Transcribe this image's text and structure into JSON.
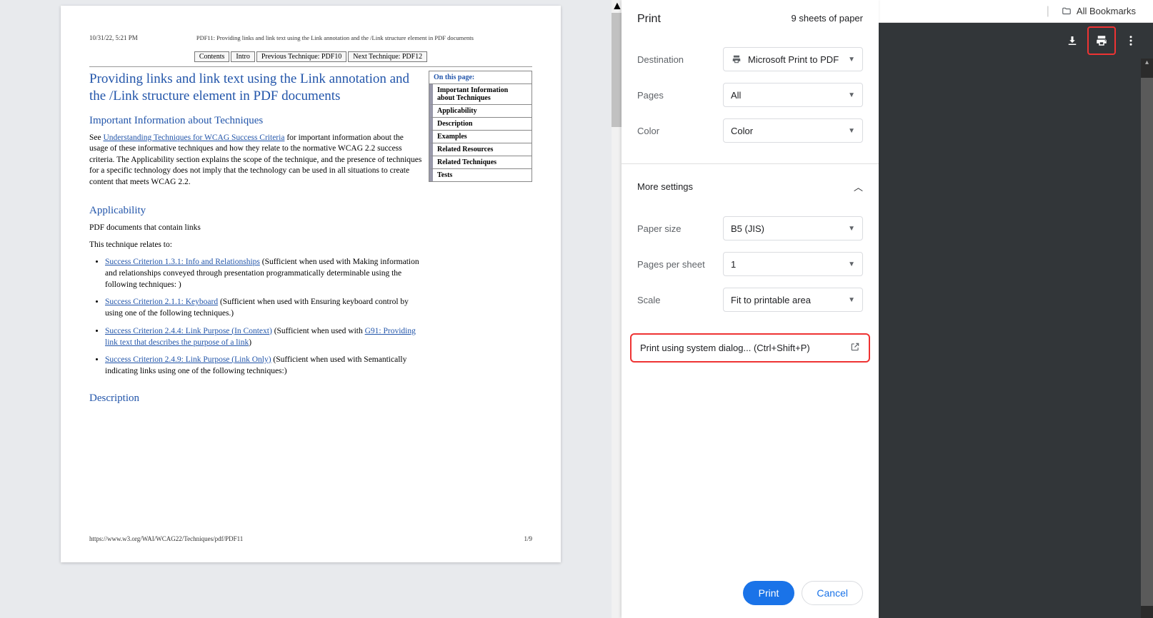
{
  "topbar": {
    "bookmarks": "All Bookmarks"
  },
  "preview": {
    "header_left": "10/31/22, 5:21 PM",
    "header_center": "PDF11: Providing links and link text using the Link annotation and the /Link structure element in PDF documents",
    "nav": [
      "Contents",
      "Intro",
      "Previous Technique: PDF10",
      "Next Technique: PDF12"
    ],
    "h1": "Providing links and link text using the Link annotation and the /Link structure element in PDF documents",
    "on_this_page": "On this page:",
    "otp_items": [
      "Important Information about Techniques",
      "Applicability",
      "Description",
      "Examples",
      "Related Resources",
      "Related Techniques",
      "Tests"
    ],
    "h2_important": "Important Information about Techniques",
    "p_see": "See ",
    "link_understanding": "Understanding Techniques for WCAG Success Criteria",
    "p_see_cont": " for important information about the usage of these informative techniques and how they relate to the normative WCAG 2.2 success criteria. The Applicability section explains the scope of the technique, and the presence of techniques for a specific technology does not imply that the technology can be used in all situations to create content that meets WCAG 2.2.",
    "h2_applicability": "Applicability",
    "p_pdf": "PDF documents that contain links",
    "p_relates": "This technique relates to:",
    "li1_link": "Success Criterion 1.3.1: Info and Relationships",
    "li1_text": " (Sufficient when used with Making information and relationships conveyed through presentation programmatically determinable using the following techniques: )",
    "li2_link": "Success Criterion 2.1.1: Keyboard",
    "li2_text": " (Sufficient when used with Ensuring keyboard control by using one of the following techniques.)",
    "li3_link": "Success Criterion 2.4.4: Link Purpose (In Context)",
    "li3_text_a": " (Sufficient when used with ",
    "li3_link_b": "G91: Providing link text that describes the purpose of a link",
    "li3_text_c": ")",
    "li4_link": "Success Criterion 2.4.9: Link Purpose (Link Only)",
    "li4_text": " (Sufficient when used with Semantically indicating links using one of the following techniques:)",
    "h2_description": "Description",
    "footer_url": "https://www.w3.org/WAI/WCAG22/Techniques/pdf/PDF11",
    "footer_page": "1/9"
  },
  "print": {
    "title": "Print",
    "sheets": "9 sheets of paper",
    "labels": {
      "destination": "Destination",
      "pages": "Pages",
      "color": "Color",
      "more": "More settings",
      "paper": "Paper size",
      "pps": "Pages per sheet",
      "scale": "Scale"
    },
    "values": {
      "destination": "Microsoft Print to PDF",
      "pages": "All",
      "color": "Color",
      "paper": "B5 (JIS)",
      "pps": "1",
      "scale": "Fit to printable area"
    },
    "system_dialog": "Print using system dialog... (Ctrl+Shift+P)",
    "print_btn": "Print",
    "cancel_btn": "Cancel"
  }
}
